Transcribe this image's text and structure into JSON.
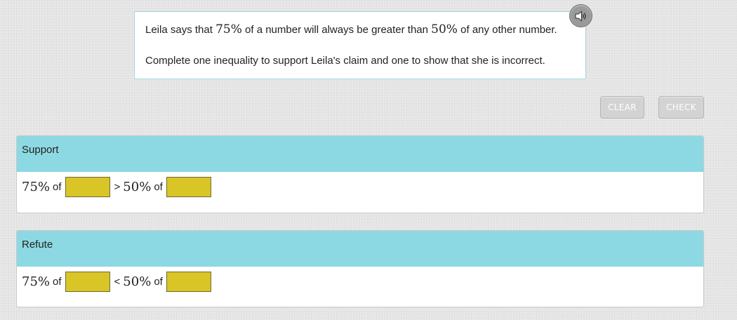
{
  "prompt": {
    "line1": {
      "part1": "Leila says that ",
      "num1": "75%",
      "part2": " of a number will always be greater than ",
      "num2": "50%",
      "part3": " of any other number."
    },
    "line2": "Complete one inequality to support Leila's claim and one to show that she is incorrect.",
    "audio_icon": "speaker-icon"
  },
  "toolbar": {
    "clear_label": "CLEAR",
    "check_label": "CHECK"
  },
  "support": {
    "header": "Support",
    "left_percent": "75%",
    "of1": "of",
    "operator": ">",
    "right_percent": "50%",
    "of2": "of",
    "left_value": "",
    "right_value": ""
  },
  "refute": {
    "header": "Refute",
    "left_percent": "75%",
    "of1": "of",
    "operator": "<",
    "right_percent": "50%",
    "of2": "of",
    "left_value": "",
    "right_value": ""
  },
  "colors": {
    "header_bg": "#8dd9e3",
    "answer_box": "#d9c526",
    "button_bg": "#d3d3d3",
    "prompt_border": "#9fd6df"
  }
}
